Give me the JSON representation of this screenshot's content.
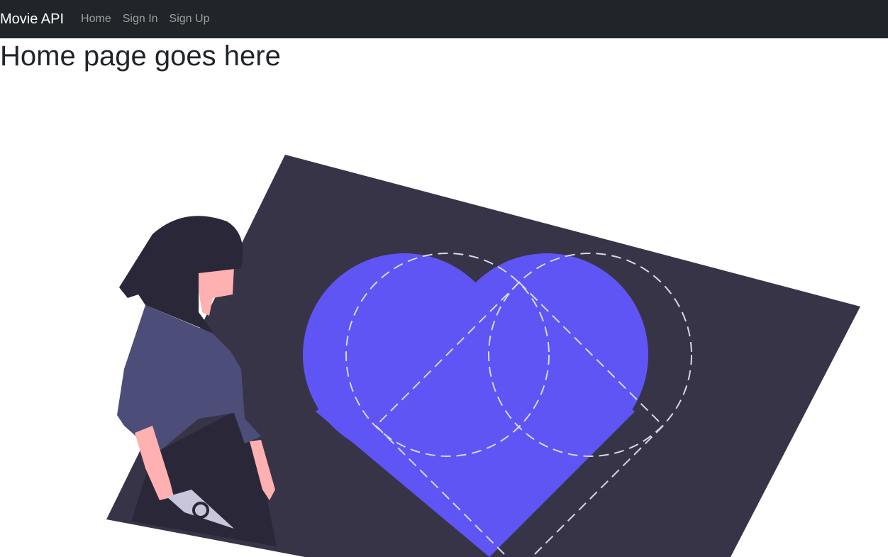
{
  "navbar": {
    "brand": "Movie API",
    "links": [
      "Home",
      "Sign In",
      "Sign Up"
    ]
  },
  "main": {
    "heading": "Home page goes here"
  },
  "colors": {
    "navbar_bg": "#212529",
    "panel": "#373448",
    "heart": "#5f55f5",
    "hair": "#2a2838",
    "shirt": "#4d4d7a",
    "skin": "#ffb0b0"
  }
}
